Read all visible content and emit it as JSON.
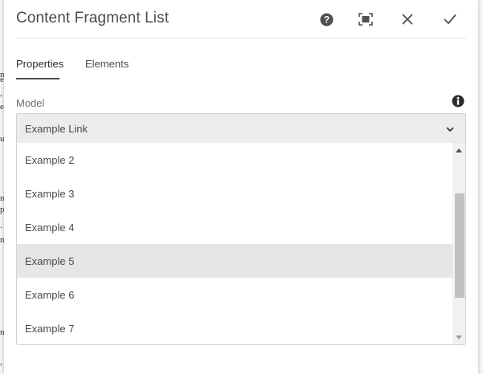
{
  "dialog": {
    "title": "Content Fragment List",
    "header_icons": [
      "help-icon",
      "fullscreen-icon",
      "close-icon",
      "done-icon"
    ]
  },
  "tabs": [
    {
      "label": "Properties",
      "active": true
    },
    {
      "label": "Elements",
      "active": false
    }
  ],
  "model_field": {
    "label": "Model",
    "selected_value": "Example Link",
    "info_icon": "info-icon"
  },
  "dropdown": {
    "options": [
      "Example 2",
      "Example 3",
      "Example 4",
      "Example 5",
      "Example 6",
      "Example 7"
    ],
    "highlighted_option": "Example 5",
    "scroll_position": 0.5
  },
  "colors": {
    "dialog_bg": "#ffffff",
    "select_bg": "#ececec",
    "highlight_bg": "#e6e6e6",
    "text": "#4b4b4b",
    "label": "#6e6e6e"
  }
}
